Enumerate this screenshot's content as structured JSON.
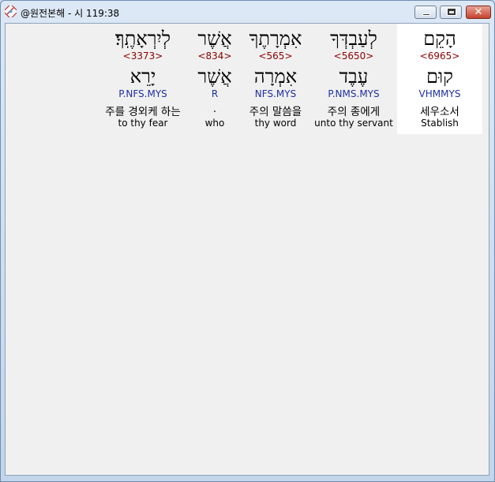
{
  "window": {
    "title": "@원전본해 - 시 119:38",
    "close_glyph": "✕"
  },
  "colors": {
    "strong": "#8b0000",
    "parse": "#1f2f9f",
    "selected_bg": "#ffffff"
  },
  "words": [
    {
      "hebrew": "לְיִרְאָתֶֽךָ׃",
      "strong": "<3373>",
      "lemma": "יָרֵא",
      "parse": "P.NFS.MYS",
      "korean": "주를 경외케 하는",
      "english": "to thy fear"
    },
    {
      "hebrew": "אֲשֶׁר",
      "strong": "<834>",
      "lemma": "אֲשֶׁר",
      "parse": "R",
      "korean": ".",
      "english": "who"
    },
    {
      "hebrew": "אִמְרָתֶךָ",
      "strong": "<565>",
      "lemma": "אִמְרָה",
      "parse": "NFS.MYS",
      "korean": "주의 말씀을",
      "english": "thy word"
    },
    {
      "hebrew": "לְעַבְדְּךָ",
      "strong": "<5650>",
      "lemma": "עֶבֶד",
      "parse": "P.NMS.MYS",
      "korean": "주의 종에게",
      "english": "unto thy servant"
    },
    {
      "hebrew": "הָקֵם",
      "strong": "<6965>",
      "lemma": "קוּם",
      "parse": "VHMMYS",
      "korean": "세우소서",
      "english": "Stablish"
    }
  ]
}
